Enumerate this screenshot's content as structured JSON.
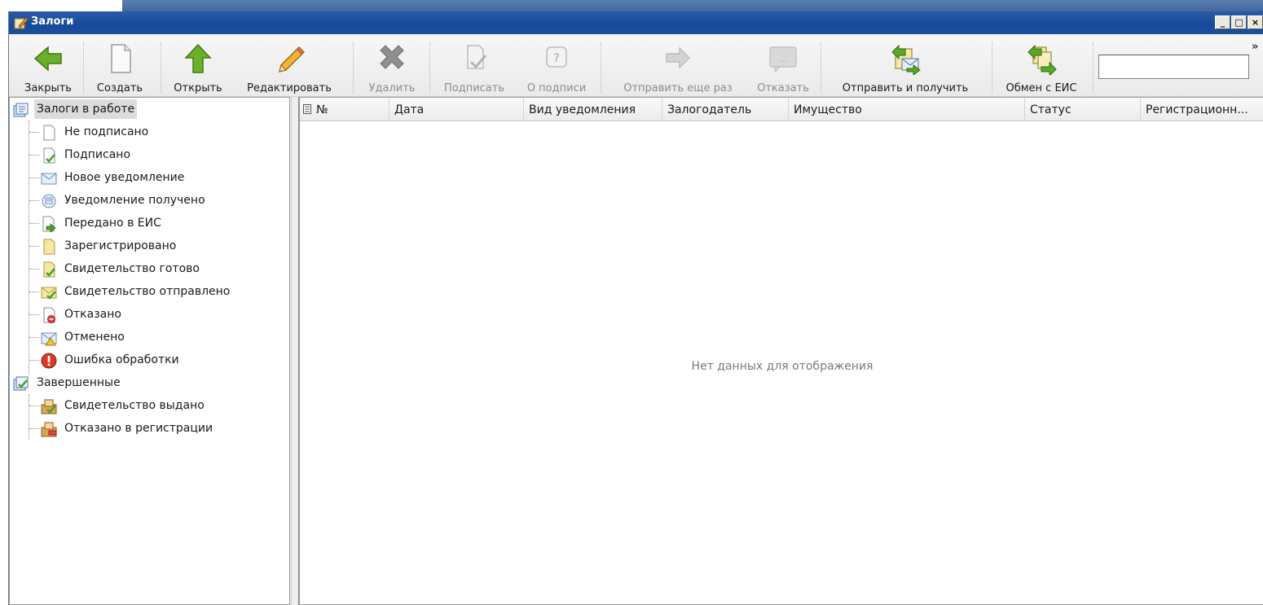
{
  "window": {
    "title": "Залоги"
  },
  "toolbar": {
    "buttons": [
      {
        "label": "Закрыть",
        "icon": "arrow-left-green-icon",
        "enabled": true
      },
      {
        "label": "Создать",
        "icon": "new-document-icon",
        "enabled": true
      },
      {
        "label": "Открыть",
        "icon": "arrow-up-green-icon",
        "enabled": true
      },
      {
        "label": "Редактировать",
        "icon": "pencil-icon",
        "enabled": true
      },
      {
        "label": "Удалить",
        "icon": "delete-x-icon",
        "enabled": false
      },
      {
        "label": "Подписать",
        "icon": "sign-icon",
        "enabled": false
      },
      {
        "label": "О подписи",
        "icon": "signature-info-icon",
        "enabled": false
      },
      {
        "label": "Отправить еще раз",
        "icon": "resend-arrow-icon",
        "enabled": false
      },
      {
        "label": "Отказать",
        "icon": "refuse-comment-icon",
        "enabled": false
      },
      {
        "label": "Отправить и получить",
        "icon": "send-receive-icon",
        "enabled": true
      },
      {
        "label": "Обмен с ЕИС",
        "icon": "eis-exchange-icon",
        "enabled": true
      }
    ],
    "search_value": "",
    "overflow_glyph": "»"
  },
  "tree": {
    "groups": [
      {
        "label": "Залоги в работе",
        "icon": "pledges-folder-icon",
        "selected": true,
        "items": [
          {
            "label": "Не подписано",
            "icon": "blank-document-icon"
          },
          {
            "label": "Подписано",
            "icon": "signed-document-icon"
          },
          {
            "label": "Новое уведомление",
            "icon": "envelope-icon"
          },
          {
            "label": "Уведомление получено",
            "icon": "received-notification-icon"
          },
          {
            "label": "Передано в ЕИС",
            "icon": "document-sent-icon"
          },
          {
            "label": "Зарегистрировано",
            "icon": "registered-document-icon"
          },
          {
            "label": "Свидетельство готово",
            "icon": "certificate-ready-icon"
          },
          {
            "label": "Свидетельство отправлено",
            "icon": "certificate-sent-icon"
          },
          {
            "label": "Отказано",
            "icon": "refused-document-icon"
          },
          {
            "label": "Отменено",
            "icon": "cancelled-warning-icon"
          },
          {
            "label": "Ошибка обработки",
            "icon": "error-icon"
          }
        ]
      },
      {
        "label": "Завершенные",
        "icon": "completed-folder-icon",
        "selected": false,
        "items": [
          {
            "label": "Свидетельство выдано",
            "icon": "certificate-issued-icon"
          },
          {
            "label": "Отказано в регистрации",
            "icon": "registration-refused-icon"
          }
        ]
      }
    ]
  },
  "grid": {
    "columns": [
      "№",
      "Дата",
      "Вид уведомления",
      "Залогодатель",
      "Имущество",
      "Статус",
      "Регистрационн..."
    ],
    "empty_message": "Нет данных для отображения"
  },
  "colors": {
    "titlebar": "#174a9a",
    "selection": "#dcdcdc",
    "disabled_text": "#8c8c8c"
  }
}
